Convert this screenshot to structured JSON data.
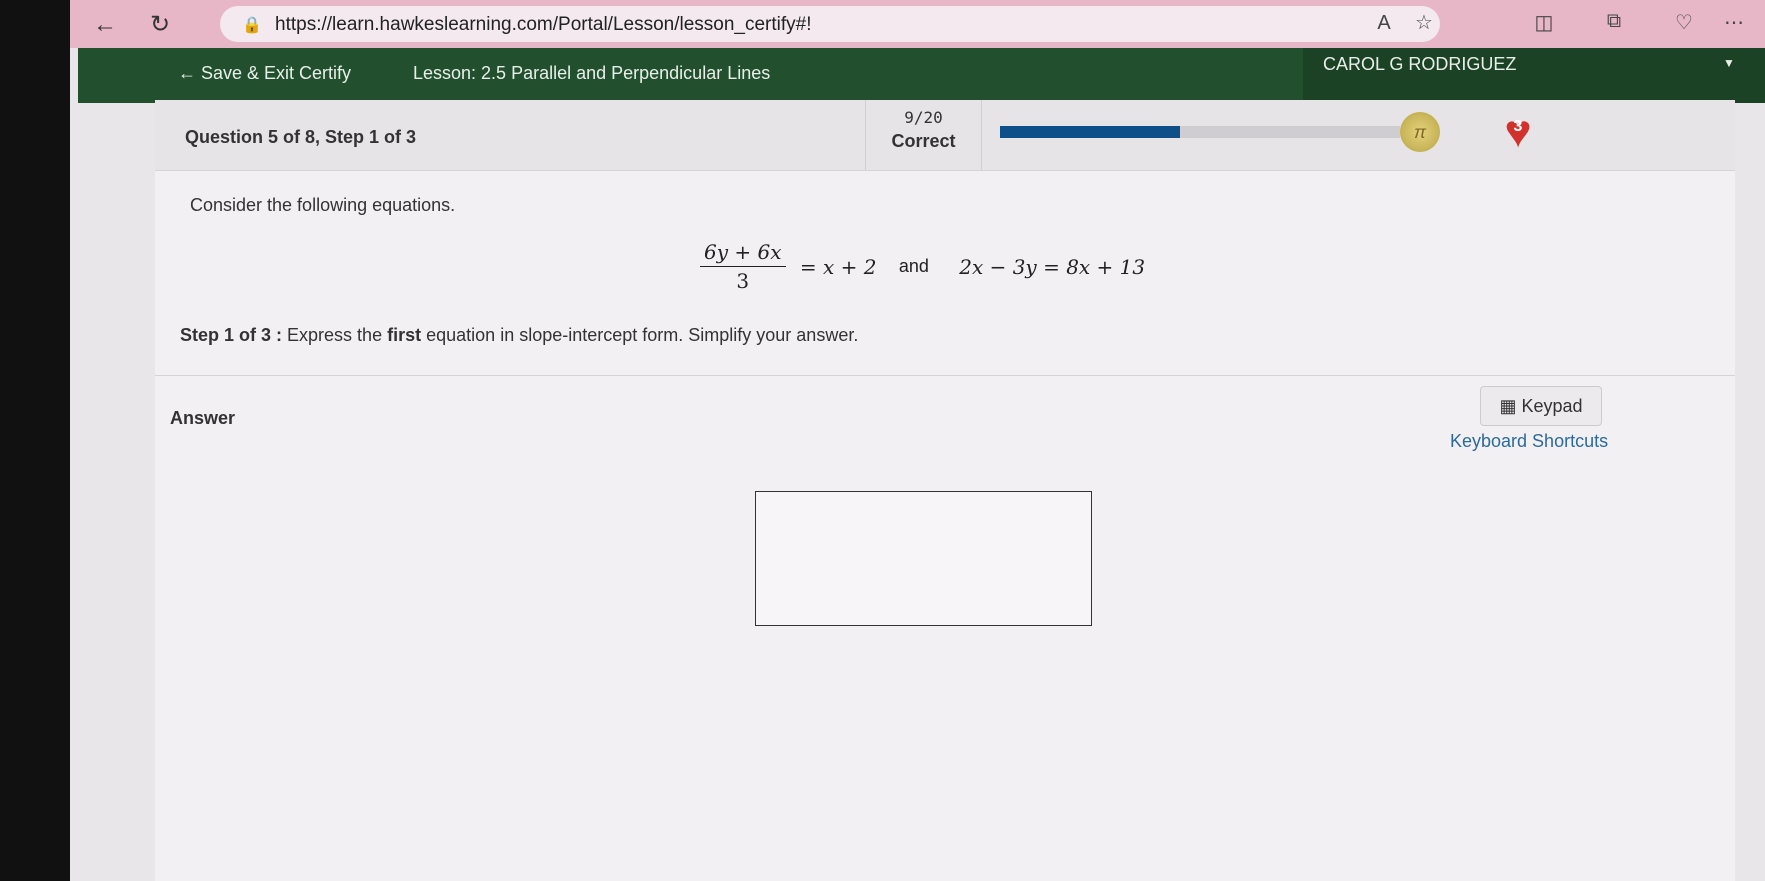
{
  "browser": {
    "url": "https://learn.hawkeslearning.com/Portal/Lesson/lesson_certify#!",
    "icons": [
      "back-icon",
      "refresh-icon",
      "lock-icon",
      "read-aloud-icon",
      "favorite-star-icon",
      "split-screen-icon",
      "collections-icon",
      "browser-essentials-icon",
      "more-menu-icon"
    ]
  },
  "appbar": {
    "save_exit": "← Save & Exit Certify",
    "lesson": "Lesson: 2.5 Parallel and Perpendicular Lines",
    "user": "CAROL G RODRIGUEZ",
    "caret": "▼"
  },
  "question": {
    "label": "Question 5 of 8, Step 1 of 3",
    "score": "9/20",
    "score_label": "Correct",
    "progress_fraction": 0.45,
    "coin_symbol": "π",
    "lives": "3"
  },
  "problem": {
    "intro": "Consider the following equations.",
    "eq1_numerator": "6y + 6x",
    "eq1_denominator": "3",
    "eq1_rhs": "= x + 2",
    "joiner": "and",
    "eq2": "2x − 3y = 8x + 13",
    "step_label": "Step 1 of 3 :",
    "step_text_pre": "Express the",
    "step_bold": "first",
    "step_text_post": "equation in slope-intercept form. Simplify your answer."
  },
  "answer": {
    "label": "Answer",
    "keypad": "Keypad",
    "shortcuts": "Keyboard Shortcuts"
  }
}
